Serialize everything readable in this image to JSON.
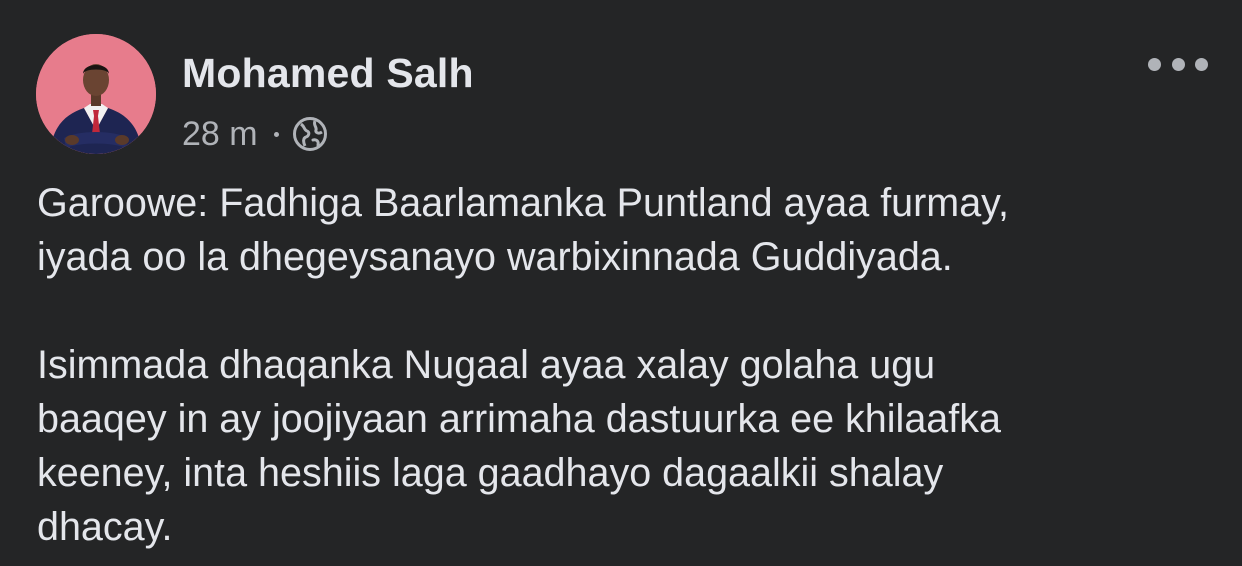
{
  "post": {
    "author": {
      "name": "Mohamed Salh",
      "avatar_icon": "profile-photo-man-in-suit",
      "avatar_bg": "#e77c8c"
    },
    "timestamp": "28 m",
    "separator": "·",
    "audience_icon": "globe-icon",
    "more_icon": "more-options-icon",
    "paragraphs": [
      "Garoowe: Fadhiga Baarlamanka Puntland ayaa furmay,\niyada oo la dhegeysanayo warbixinnada Guddiyada.",
      "Isimmada dhaqanka Nugaal ayaa xalay golaha ugu\nbaaqey in ay joojiyaan arrimaha dastuurka ee khilaafka\nkeeney, inta heshiis laga gaadhayo dagaalkii shalay\ndhacay."
    ]
  },
  "colors": {
    "background": "#242526",
    "primary_text": "#e4e6eb",
    "secondary_text": "#b0b3b8"
  }
}
